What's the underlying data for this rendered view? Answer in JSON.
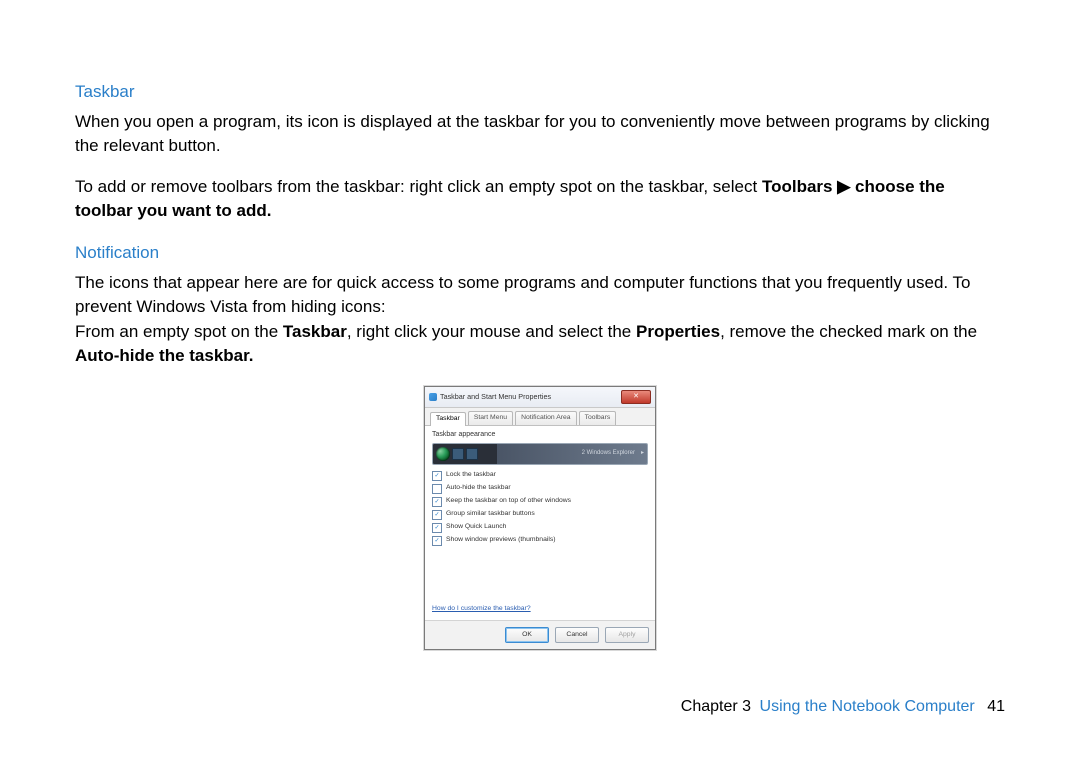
{
  "sections": {
    "taskbar": {
      "heading": "Taskbar",
      "p1": "When you open a program, its icon is displayed at the taskbar for you to conveniently move between programs by clicking the relevant button.",
      "p2a": "To add or remove toolbars from the taskbar: right click an empty spot on the taskbar, select ",
      "p2b": "Toolbars ",
      "p2arrow": "▶",
      "p2c": " choose the toolbar you want to add."
    },
    "notification": {
      "heading": "Notification",
      "p1": "The icons that appear here are for quick access to some programs and computer functions that you frequently used. To prevent Windows Vista from hiding icons:",
      "p2a": "From an empty spot on the ",
      "p2b": "Taskbar",
      "p2c": ", right click your mouse and select the ",
      "p2d": "Properties",
      "p2e": ", remove the checked mark on the ",
      "p2f": "Auto-hide the taskbar."
    }
  },
  "dialog": {
    "title": "Taskbar and Start Menu Properties",
    "tabs": [
      "Taskbar",
      "Start Menu",
      "Notification Area",
      "Toolbars"
    ],
    "active_tab": 0,
    "section_label": "Taskbar appearance",
    "preview_text": "2 Windows Explorer",
    "options": [
      {
        "label": "Lock the taskbar",
        "checked": true
      },
      {
        "label": "Auto-hide the taskbar",
        "checked": false
      },
      {
        "label": "Keep the taskbar on top of other windows",
        "checked": true
      },
      {
        "label": "Group similar taskbar buttons",
        "checked": true
      },
      {
        "label": "Show Quick Launch",
        "checked": true
      },
      {
        "label": "Show window previews (thumbnails)",
        "checked": true
      }
    ],
    "help_link": "How do I customize the taskbar?",
    "buttons": {
      "ok": "OK",
      "cancel": "Cancel",
      "apply": "Apply"
    }
  },
  "footer": {
    "chapter_label": "Chapter 3",
    "chapter_title": "Using the Notebook Computer",
    "page_number": "41"
  }
}
